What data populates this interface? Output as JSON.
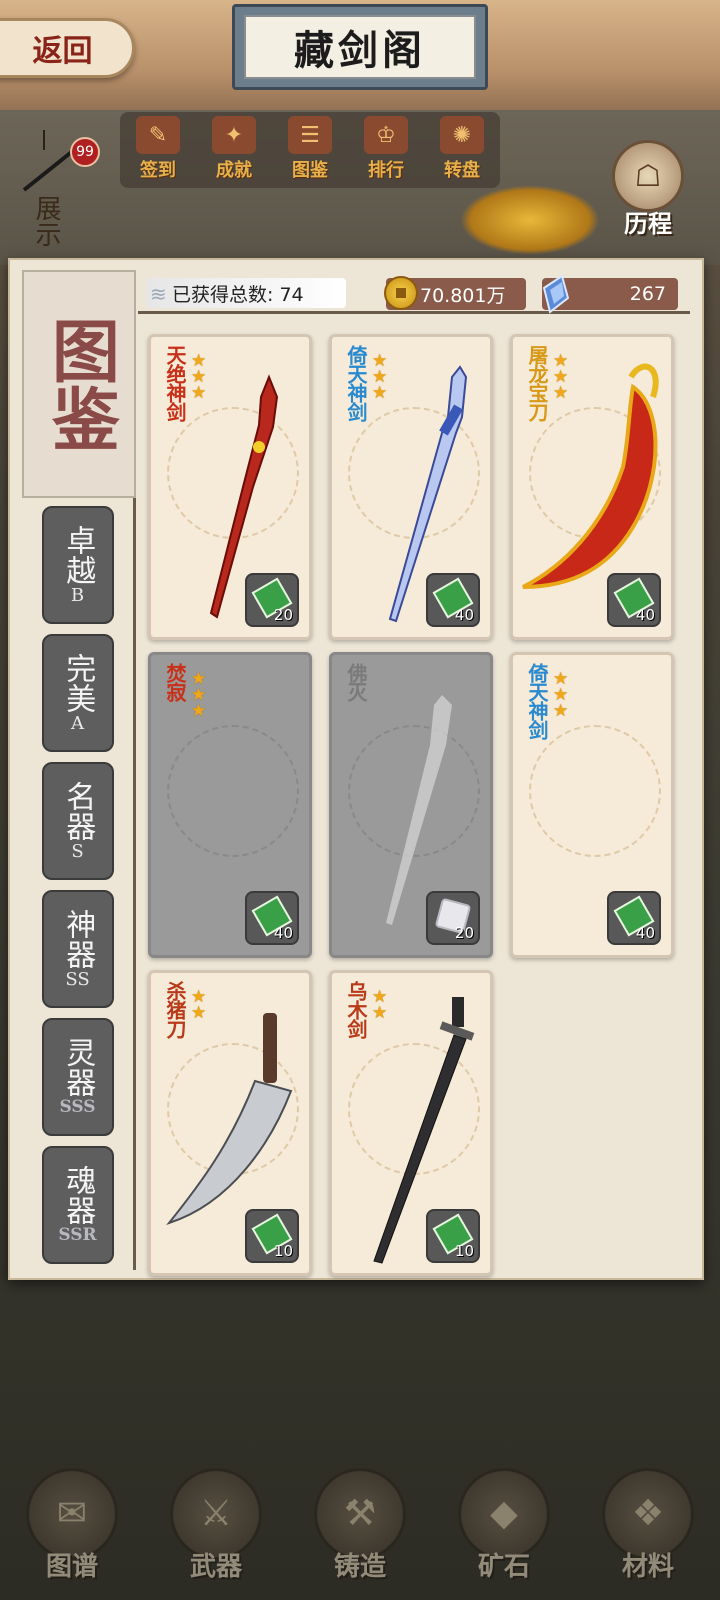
{
  "header": {
    "back_label": "返回",
    "title": "藏剑阁"
  },
  "menu": [
    {
      "label": "签到",
      "icon": "sign-in-icon"
    },
    {
      "label": "成就",
      "icon": "achievement-icon"
    },
    {
      "label": "图鉴",
      "icon": "catalog-icon"
    },
    {
      "label": "排行",
      "icon": "ranking-icon"
    },
    {
      "label": "转盘",
      "icon": "wheel-icon"
    }
  ],
  "left_tag": {
    "badge": "99",
    "label": "展示"
  },
  "history": {
    "label": "历程"
  },
  "panel": {
    "sidebar_title": "图鉴",
    "ranks": [
      {
        "name": "卓越",
        "grade": "B"
      },
      {
        "name": "完美",
        "grade": "A"
      },
      {
        "name": "名器",
        "grade": "S"
      },
      {
        "name": "神器",
        "grade": "SS"
      },
      {
        "name": "灵器",
        "grade": "SSS"
      },
      {
        "name": "魂器",
        "grade": "SSR"
      }
    ],
    "total_label": "已获得总数: 74",
    "coins": "70.801万",
    "gems": "267"
  },
  "cards": [
    {
      "name": "天绝神剑",
      "stars": 3,
      "cost": "20",
      "locked": false,
      "name_color": "#c83018",
      "weapon": "red-sword"
    },
    {
      "name": "倚天神剑",
      "stars": 3,
      "cost": "40",
      "locked": false,
      "name_color": "#2a8ad0",
      "weapon": "blue-sword"
    },
    {
      "name": "屠龙宝刀",
      "stars": 3,
      "cost": "40",
      "locked": false,
      "name_color": "#d89818",
      "weapon": "gold-blade"
    },
    {
      "name": "焚寂",
      "stars": 3,
      "cost": "40",
      "locked": true,
      "name_color": "#c83018",
      "weapon": ""
    },
    {
      "name": "佛灭",
      "stars": 0,
      "cost": "20",
      "locked": true,
      "name_color": "#7a7a7a",
      "weapon": "ghost-sword"
    },
    {
      "name": "倚天神剑",
      "stars": 3,
      "cost": "40",
      "locked": false,
      "name_color": "#2a8ad0",
      "weapon": ""
    },
    {
      "name": "杀猪刀",
      "stars": 2,
      "cost": "10",
      "locked": false,
      "name_color": "#b83a18",
      "weapon": "cleaver"
    },
    {
      "name": "乌木剑",
      "stars": 2,
      "cost": "10",
      "locked": false,
      "name_color": "#b83a18",
      "weapon": "dark-sword"
    }
  ],
  "bottom_nav": [
    {
      "label": "图谱",
      "icon": "scroll-icon"
    },
    {
      "label": "武器",
      "icon": "swords-icon"
    },
    {
      "label": "铸造",
      "icon": "anvil-icon"
    },
    {
      "label": "矿石",
      "icon": "ore-icon"
    },
    {
      "label": "材料",
      "icon": "material-icon"
    }
  ]
}
